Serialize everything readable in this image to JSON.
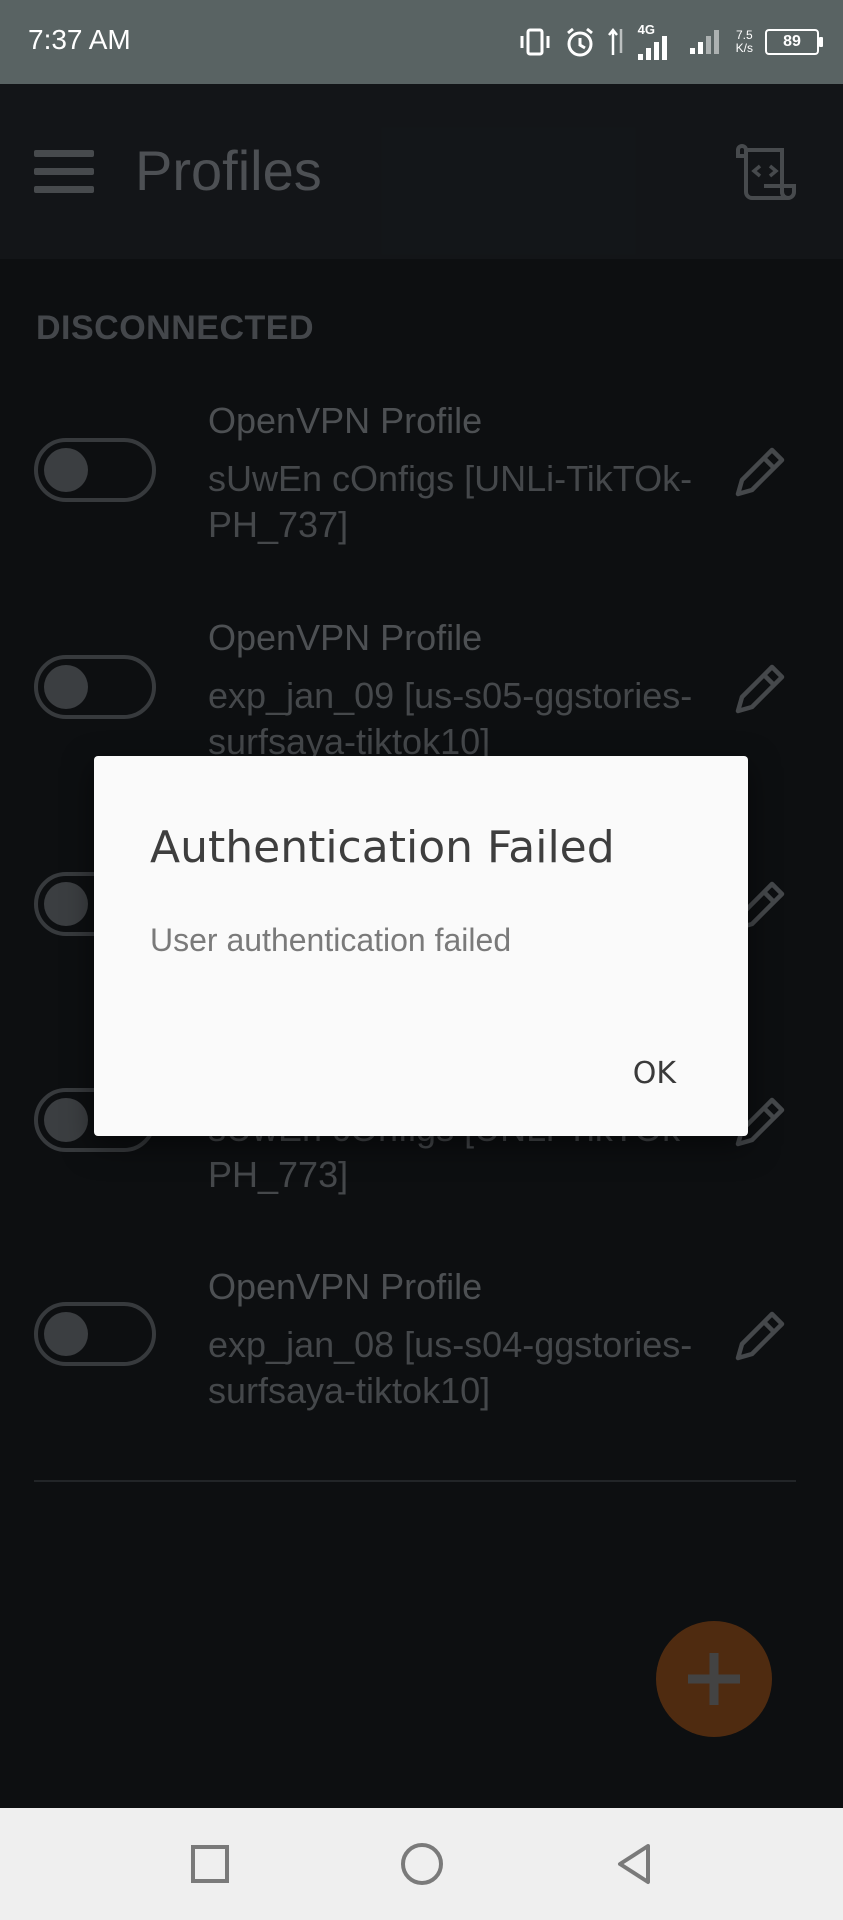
{
  "status": {
    "time": "7:37 AM",
    "network": "4G",
    "speed_value": "7.5",
    "speed_unit": "K/s",
    "battery": "89"
  },
  "appbar": {
    "title": "Profiles"
  },
  "section": {
    "header": "DISCONNECTED"
  },
  "profiles": [
    {
      "type": "OpenVPN Profile",
      "name": "sUwEn cOnfigs [UNLi-TikTOk-PH_737]"
    },
    {
      "type": "OpenVPN Profile",
      "name": "exp_jan_09 [us-s05-ggstories-surfsaya-tiktok10]"
    },
    {
      "type": "",
      "name": ""
    },
    {
      "type": "",
      "name": "sUwEn cOnfigs [UNLi-TikTOk-PH_773]"
    },
    {
      "type": "OpenVPN Profile",
      "name": "exp_jan_08 [us-s04-ggstories-surfsaya-tiktok10]"
    }
  ],
  "dialog": {
    "title": "Authentication Failed",
    "message": "User authentication failed",
    "ok_label": "OK"
  },
  "colors": {
    "status_bar": "#596363",
    "app_bar": "#1a1d21",
    "background": "#121417",
    "fab": "#6a3a16",
    "dialog": "#fafafa"
  },
  "icons": {
    "menu": "hamburger-menu-icon",
    "import": "import-profile-icon",
    "edit": "pencil-icon",
    "fab": "plus-icon",
    "nav": [
      "square-recents-icon",
      "circle-home-icon",
      "triangle-back-icon"
    ]
  }
}
